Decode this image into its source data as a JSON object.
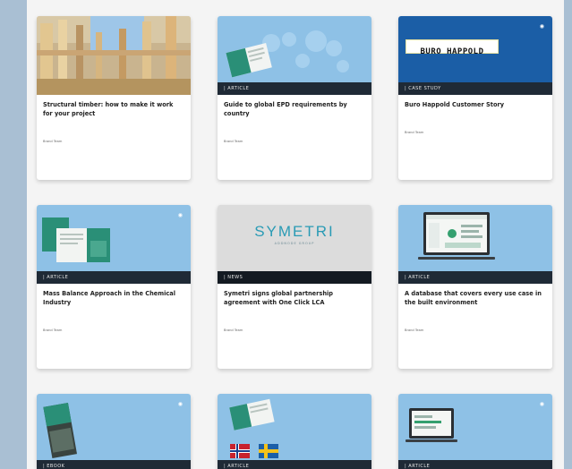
{
  "cards": [
    {
      "title": "Structural timber: how to make it work for your project",
      "tag": "",
      "meta": "Brand Team"
    },
    {
      "title": "Guide to global EPD requirements by country",
      "tag": "| ARTICLE",
      "meta": "Brand Team"
    },
    {
      "title": "Buro Happold Customer Story",
      "tag": "| CASE STUDY",
      "meta": "Brand Team",
      "logo": "BURO HAPPOLD"
    },
    {
      "title": "Mass Balance Approach in the Chemical Industry",
      "tag": "| ARTICLE",
      "meta": "Brand Team"
    },
    {
      "title": "Symetri signs global partnership agreement with One Click LCA",
      "tag": "| NEWS",
      "meta": "Brand Team",
      "logo": "SYMETRI",
      "logo_sub": "ADDNODE GROUP"
    },
    {
      "title": "A database that covers every use case in the built environment",
      "tag": "| ARTICLE",
      "meta": "Brand Team"
    },
    {
      "tag": "| EBOOK"
    },
    {
      "tag": "| ARTICLE"
    },
    {
      "tag": "| ARTICLE"
    }
  ],
  "colors": {
    "page_bg": "#a9bfd3",
    "band": "#1f2a36",
    "sky": "#8ec1e6",
    "buro_bg": "#1b5ea6"
  }
}
